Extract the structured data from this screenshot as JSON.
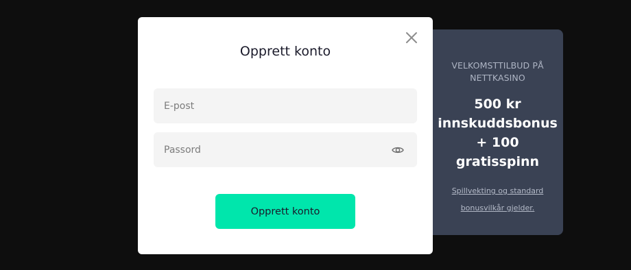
{
  "modal": {
    "title": "Opprett konto",
    "close_icon": "close-icon",
    "email": {
      "placeholder": "E-post",
      "value": ""
    },
    "password": {
      "placeholder": "Passord",
      "value": "",
      "toggle_icon": "eye-icon"
    },
    "submit_label": "Opprett konto",
    "submit_color": "#00e6ac"
  },
  "promo": {
    "heading": "VELKOMSTTILBUD PÅ NETTKASINO",
    "offer": "500 kr innskuddsbonus + 100 gratisspinn",
    "terms_link": "Spillvekting og standard bonusvilkår gjelder.",
    "background_color": "#3a4254"
  },
  "overlay_color": "#0e0e0e"
}
